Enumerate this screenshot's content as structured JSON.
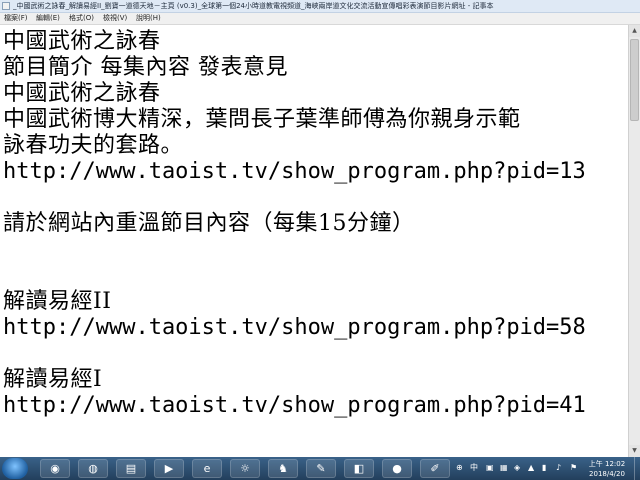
{
  "window": {
    "title": "_中國武術之詠春_解讀易經II_劉寶一道德天地－主頁 (v0.3)_全球第一個24小時道教電視頻道_海峽兩岸道文化交流活動宣傳唱彩表演節目影片網址 - 記事本"
  },
  "menu": {
    "file": "檔案(F)",
    "edit": "編輯(E)",
    "format": "格式(O)",
    "view": "檢視(V)",
    "help": "說明(H)"
  },
  "document": {
    "lines": [
      "中國武術之詠春",
      "節目簡介 每集內容 發表意見",
      "中國武術之詠春",
      "中國武術博大精深，葉問長子葉準師傅為你親身示範",
      "詠春功夫的套路。",
      "http://www.taoist.tv/show_program.php?pid=13",
      "",
      "請於網站內重溫節目內容（每集15分鐘）",
      "",
      "",
      "解讀易經II",
      "http://www.taoist.tv/show_program.php?pid=58",
      "",
      "解讀易經I",
      "http://www.taoist.tv/show_program.php?pid=41"
    ]
  },
  "taskbar": {
    "tray_lang": "中",
    "tray_ime": "⊕",
    "clock_time": "上午 12:02",
    "clock_date": "2018/4/20"
  }
}
